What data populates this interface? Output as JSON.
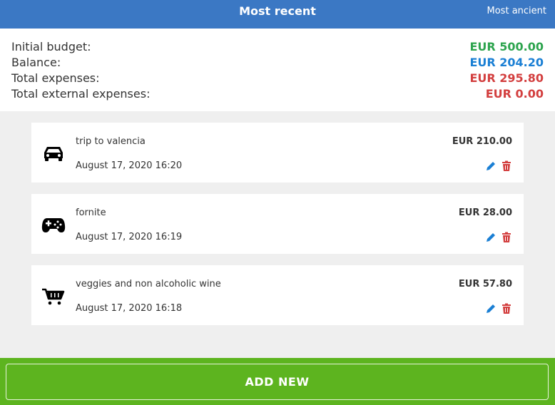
{
  "header": {
    "active_tab": "Most recent",
    "other_tab": "Most ancient"
  },
  "summary": {
    "rows": [
      {
        "label": "Initial budget:",
        "value": "EUR 500.00",
        "color": "#2da44e"
      },
      {
        "label": "Balance:",
        "value": "EUR 204.20",
        "color": "#1a7fd4"
      },
      {
        "label": "Total expenses:",
        "value": "EUR 295.80",
        "color": "#d33f3f"
      },
      {
        "label": "Total external expenses:",
        "value": "EUR 0.00",
        "color": "#d33f3f"
      }
    ]
  },
  "expenses": [
    {
      "icon": "car-icon",
      "title": "trip to valencia",
      "amount": "EUR 210.00",
      "date": "August 17, 2020 16:20"
    },
    {
      "icon": "gamepad-icon",
      "title": "fornite",
      "amount": "EUR 28.00",
      "date": "August 17, 2020 16:19"
    },
    {
      "icon": "shopping-cart-icon",
      "title": "veggies and non alcoholic wine",
      "amount": "EUR 57.80",
      "date": "August 17, 2020 16:18"
    }
  ],
  "footer": {
    "add_label": "ADD NEW"
  },
  "colors": {
    "header_bg": "#3b78c4",
    "footer_bg": "#5db41f",
    "edit_icon": "#1a7fd4",
    "delete_icon": "#d33f3f"
  }
}
